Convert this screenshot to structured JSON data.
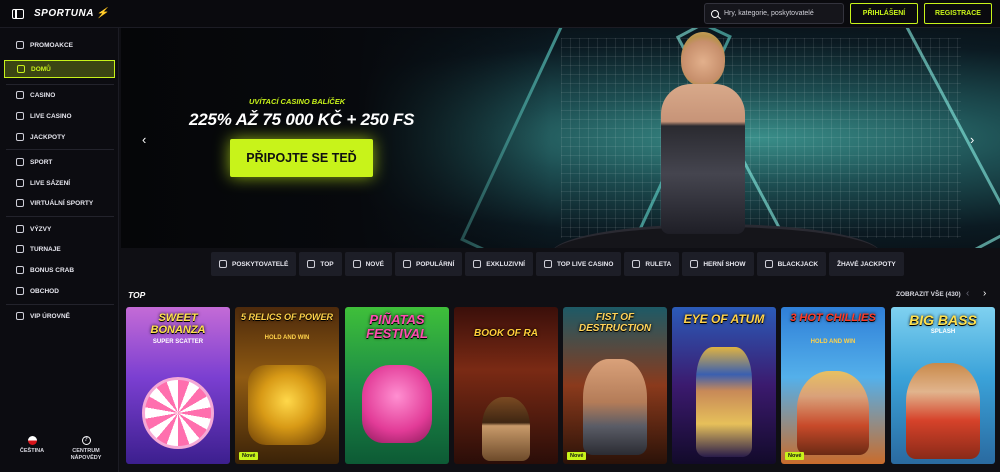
{
  "header": {
    "logo_text": "SPORTUNA",
    "search_placeholder": "Hry, kategorie, poskytovatelé",
    "login_label": "PŘIHLÁŠENÍ",
    "register_label": "REGISTRACE"
  },
  "sidebar": {
    "items": [
      {
        "label": "PROMOAKCE",
        "icon": "gift-icon"
      },
      {
        "label": "DOMŮ",
        "icon": "home-icon"
      },
      {
        "label": "CASINO",
        "icon": "cards-icon"
      },
      {
        "label": "LIVE CASINO",
        "icon": "live-icon"
      },
      {
        "label": "JACKPOTY",
        "icon": "jackpot-icon"
      },
      {
        "label": "SPORT",
        "icon": "ball-icon"
      },
      {
        "label": "LIVE SÁZENÍ",
        "icon": "live-bet-icon"
      },
      {
        "label": "VIRTUÁLNÍ SPORTY",
        "icon": "virtual-icon"
      },
      {
        "label": "VÝZVY",
        "icon": "trophy-icon"
      },
      {
        "label": "TURNAJE",
        "icon": "tournament-icon"
      },
      {
        "label": "BONUS CRAB",
        "icon": "crab-icon"
      },
      {
        "label": "OBCHOD",
        "icon": "shop-icon"
      },
      {
        "label": "VIP ÚROVNĚ",
        "icon": "diamond-icon"
      }
    ],
    "language_label": "ČEŠTINA",
    "help_label_1": "CENTRUM",
    "help_label_2": "NÁPOVĚDY"
  },
  "banner": {
    "subtitle": "UVÍTACÍ CASINO BALÍČEK",
    "title": "225% AŽ 75 000 KČ + 250 FS",
    "cta_label": "PŘIPOJTE SE TEĎ"
  },
  "categories": [
    "POSKYTOVATELÉ",
    "TOP",
    "NOVÉ",
    "POPULÁRNÍ",
    "EXKLUZIVNÍ",
    "TOP LIVE CASINO",
    "RULETA",
    "HERNÍ SHOW",
    "BLACKJACK",
    "ŽHAVÉ JACKPOTY"
  ],
  "section": {
    "title": "TOP",
    "show_all": "ZOBRAZIT VŠE (430)"
  },
  "games": [
    {
      "title": "SWEET BONANZA",
      "sub": "SUPER SCATTER",
      "badge": ""
    },
    {
      "title": "5 RELICS OF POWER",
      "sub": "HOLD AND WIN",
      "badge": "Nové"
    },
    {
      "title": "PIÑATAS FESTIVAL",
      "sub": "",
      "badge": ""
    },
    {
      "title": "BOOK OF RA",
      "sub": "",
      "badge": ""
    },
    {
      "title": "FIST OF DESTRUCTION",
      "sub": "",
      "badge": "Nové"
    },
    {
      "title": "EYE OF ATUM",
      "sub": "",
      "badge": ""
    },
    {
      "title": "3 HOT CHILLIES",
      "sub": "HOLD AND WIN",
      "badge": "Nové"
    },
    {
      "title": "BIG BASS",
      "sub": "SPLASH",
      "badge": ""
    }
  ],
  "colors": {
    "accent": "#c8f31a",
    "background": "#0f0f14"
  }
}
